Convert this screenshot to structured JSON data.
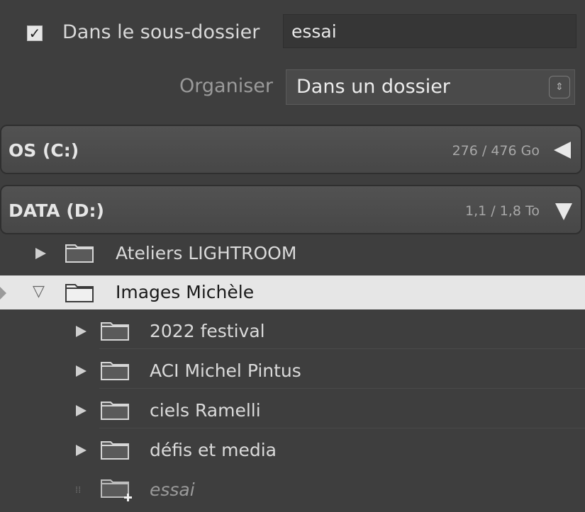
{
  "export": {
    "subfolder_checkbox": true,
    "subfolder_label": "Dans le sous-dossier",
    "subfolder_value": "essai",
    "organise_label": "Organiser",
    "organise_value": "Dans un dossier"
  },
  "volumes": [
    {
      "name": "OS (C:)",
      "size": "276 / 476 Go",
      "state": "collapsed"
    },
    {
      "name": "DATA (D:)",
      "size": "1,1 / 1,8 To",
      "state": "expanded"
    }
  ],
  "folders": [
    {
      "label": "Ateliers LIGHTROOM",
      "level": 0,
      "state": "collapsed"
    },
    {
      "label": "Images Michèle",
      "level": 0,
      "state": "expanded",
      "selected": true
    },
    {
      "label": "2022 festival",
      "level": 1,
      "state": "collapsed"
    },
    {
      "label": "ACI Michel Pintus",
      "level": 1,
      "state": "collapsed"
    },
    {
      "label": "ciels Ramelli",
      "level": 1,
      "state": "collapsed"
    },
    {
      "label": "défis et media",
      "level": 1,
      "state": "collapsed"
    },
    {
      "label": "essai",
      "level": 1,
      "state": "new"
    }
  ],
  "colors": {
    "panel_bg": "#3e3e3e",
    "selection_bg": "#e6e6e6",
    "text": "#d4d4d4"
  },
  "icons": {
    "checkbox": "checkmark-icon",
    "select": "updown-arrows-icon",
    "collapsed": "triangle-right-icon",
    "expanded": "triangle-down-icon",
    "folder": "folder-icon",
    "new_folder": "folder-plus-icon"
  }
}
